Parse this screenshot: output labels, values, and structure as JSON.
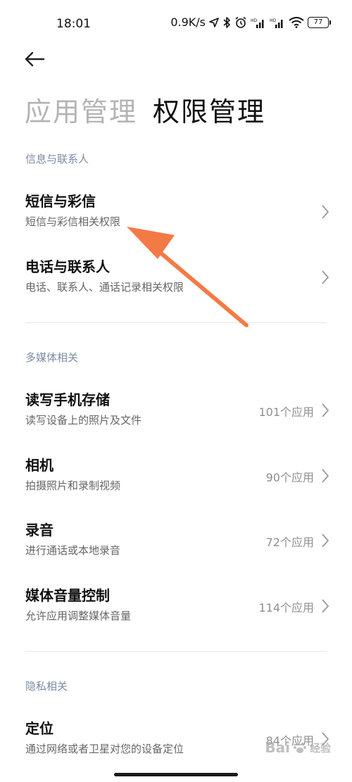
{
  "status_bar": {
    "time": "18:01",
    "speed": "0.9K/s",
    "battery": "77"
  },
  "header": {
    "tab_app_management": "应用管理",
    "tab_permission_management": "权限管理"
  },
  "sections": {
    "messages_contacts": {
      "label": "信息与联系人",
      "items": [
        {
          "title": "短信与彩信",
          "subtitle": "短信与彩信相关权限"
        },
        {
          "title": "电话与联系人",
          "subtitle": "电话、联系人、通话记录相关权限"
        }
      ]
    },
    "multimedia": {
      "label": "多媒体相关",
      "items": [
        {
          "title": "读写手机存储",
          "subtitle": "读写设备上的照片及文件",
          "count": "101个应用"
        },
        {
          "title": "相机",
          "subtitle": "拍摄照片和录制视频",
          "count": "90个应用"
        },
        {
          "title": "录音",
          "subtitle": "进行通话或本地录音",
          "count": "72个应用"
        },
        {
          "title": "媒体音量控制",
          "subtitle": "允许应用调整媒体音量",
          "count": "114个应用"
        }
      ]
    },
    "privacy": {
      "label": "隐私相关",
      "items": [
        {
          "title": "定位",
          "subtitle": "通过网络或者卫星对您的设备定位",
          "count": "84个应用"
        }
      ]
    }
  },
  "annotation": {
    "arrow_color": "#f47a45"
  },
  "watermark": {
    "text": "Bai",
    "sub": "经验"
  },
  "icons": {
    "back": "arrow-left-icon",
    "chevron": "chevron-right-icon",
    "location": "location-icon",
    "bluetooth": "bluetooth-icon",
    "alarm": "alarm-icon",
    "signal": "signal-icon",
    "wifi": "wifi-icon",
    "battery": "battery-icon"
  }
}
